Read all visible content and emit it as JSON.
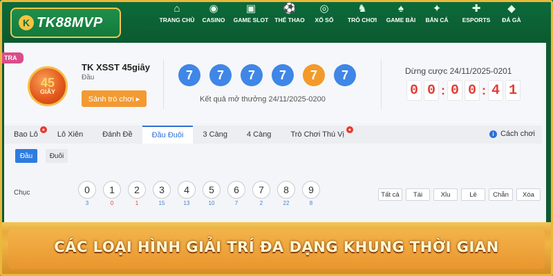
{
  "brand": {
    "logo_text": "TK88MVP",
    "logo_mark": "K"
  },
  "nav": [
    {
      "icon": "home-icon",
      "glyph": "⌂",
      "label": "TRANG CHỦ"
    },
    {
      "icon": "casino-chip-icon",
      "glyph": "◉",
      "label": "CASINO"
    },
    {
      "icon": "slot-machine-icon",
      "glyph": "▣",
      "label": "GAME SLOT"
    },
    {
      "icon": "soccer-ball-icon",
      "glyph": "⚽",
      "label": "THỂ THAO"
    },
    {
      "icon": "lottery-ball-icon",
      "glyph": "◎",
      "label": "XỔ SỐ"
    },
    {
      "icon": "chess-piece-icon",
      "glyph": "♞",
      "label": "TRÒ CHƠI"
    },
    {
      "icon": "playing-card-icon",
      "glyph": "♠",
      "label": "GAME BÀI"
    },
    {
      "icon": "fish-icon",
      "glyph": "✦",
      "label": "BẮN CÁ"
    },
    {
      "icon": "gamepad-icon",
      "glyph": "✚",
      "label": "ESPORTS"
    },
    {
      "icon": "game-icon",
      "glyph": "◆",
      "label": "ĐÁ GÀ"
    }
  ],
  "side_tag": "TRA",
  "game": {
    "logo_number": "45",
    "logo_unit": "GIÂY",
    "title": "TK XSST 45giây",
    "subtitle": "Đầu",
    "hall_button": "Sảnh trò chơi ▸",
    "balls": [
      {
        "value": "7",
        "color": "#3f86e6"
      },
      {
        "value": "7",
        "color": "#3f86e6"
      },
      {
        "value": "7",
        "color": "#3f86e6"
      },
      {
        "value": "7",
        "color": "#3f86e6"
      },
      {
        "value": "7",
        "color": "#f39a2b"
      },
      {
        "value": "7",
        "color": "#3f86e6"
      }
    ],
    "result_text": "Kết quả mở thưởng 24/11/2025-0200",
    "stop_text": "Dừng cược 24/11/2025-0201",
    "timer": [
      "0",
      "0",
      "0",
      "0",
      "4",
      "1"
    ]
  },
  "tabs": [
    {
      "label": "Bao Lô",
      "hot": true,
      "active": false
    },
    {
      "label": "Lô Xiên",
      "hot": false,
      "active": false
    },
    {
      "label": "Đánh Đề",
      "hot": false,
      "active": false
    },
    {
      "label": "Đầu Đuôi",
      "hot": false,
      "active": true
    },
    {
      "label": "3 Càng",
      "hot": false,
      "active": false
    },
    {
      "label": "4 Càng",
      "hot": false,
      "active": false
    },
    {
      "label": "Trò Chơi Thú Vị",
      "hot": true,
      "active": false
    }
  ],
  "howto_label": "Cách chơi",
  "subtabs": [
    {
      "label": "Đầu",
      "active": true
    },
    {
      "label": "Đuôi",
      "active": false
    }
  ],
  "row_label": "Chục",
  "numbers": [
    {
      "n": "0",
      "count": "3",
      "color": "#3f7fd9"
    },
    {
      "n": "1",
      "count": "0",
      "color": "#e1403a"
    },
    {
      "n": "2",
      "count": "1",
      "color": "#e1403a"
    },
    {
      "n": "3",
      "count": "15",
      "color": "#3f7fd9"
    },
    {
      "n": "4",
      "count": "13",
      "color": "#3f7fd9"
    },
    {
      "n": "5",
      "count": "10",
      "color": "#3f7fd9"
    },
    {
      "n": "6",
      "count": "7",
      "color": "#3f7fd9"
    },
    {
      "n": "7",
      "count": "2",
      "color": "#3f7fd9"
    },
    {
      "n": "8",
      "count": "22",
      "color": "#3f7fd9"
    },
    {
      "n": "9",
      "count": "8",
      "color": "#3f7fd9"
    }
  ],
  "quick_buttons": [
    "Tất cả",
    "Tài",
    "Xỉu",
    "Lẻ",
    "Chẵn",
    "Xóa"
  ],
  "banner_text": "CÁC LOẠI HÌNH GIẢI TRÍ ĐA DẠNG KHUNG THỜI GIAN"
}
